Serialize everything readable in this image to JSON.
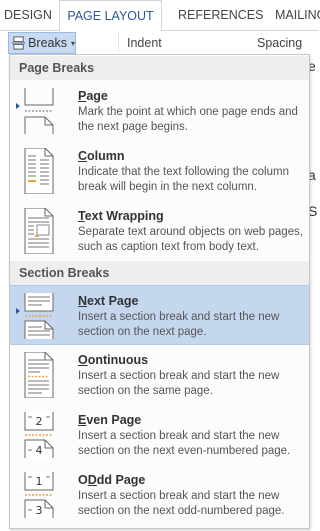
{
  "ribbon": {
    "tabs": [
      {
        "label": "DESIGN"
      },
      {
        "label": "PAGE LAYOUT"
      },
      {
        "label": "REFERENCES"
      },
      {
        "label": "MAILING"
      }
    ],
    "active_tab": "PAGE LAYOUT",
    "breaks_button": {
      "label": "Breaks",
      "icon": "breaks-icon",
      "caret": "▾"
    },
    "indent_label": "Indent",
    "spacing_label": "Spacing"
  },
  "document_background": {
    "visible_glyphs": [
      "e",
      "a",
      "S"
    ]
  },
  "colors": {
    "accent": "#2b579a",
    "hover_bg": "#c5d7ee",
    "section_header_bg": "#eeeeee",
    "page_icon_orange": "#e8a54c"
  },
  "menu": {
    "page_breaks_header": "Page Breaks",
    "section_breaks_header": "Section Breaks",
    "page_breaks": [
      {
        "accel": "P",
        "rest": "age",
        "icon": "page-break-icon",
        "desc": "Mark the point at which one page ends and the next page begins."
      },
      {
        "accel": "C",
        "rest": "olumn",
        "icon": "column-break-icon",
        "desc": "Indicate that the text following the column break will begin in the next column."
      },
      {
        "accel": "T",
        "rest": "ext Wrapping",
        "icon": "text-wrapping-icon",
        "desc": "Separate text around objects on web pages, such as caption text from body text."
      }
    ],
    "section_breaks": [
      {
        "accel": "N",
        "rest": "ext Page",
        "icon": "next-page-icon",
        "desc": "Insert a section break and start the new section on the next page.",
        "selected": true
      },
      {
        "accel": "O",
        "rest": "ontinuous",
        "icon": "continuous-icon",
        "desc": "Insert a section break and start the new section on the same page."
      },
      {
        "accel": "E",
        "rest": "ven Page",
        "icon": "even-page-icon",
        "desc": "Insert a section break and start the new section on the next even-numbered page.",
        "badge_top": "2",
        "badge_bottom": "4"
      },
      {
        "accel": "D",
        "rest": "dd Page",
        "icon": "odd-page-icon",
        "title_prefix": "O",
        "desc": "Insert a section break and start the new section on the next odd-numbered page.",
        "badge_top": "1",
        "badge_bottom": "3"
      }
    ]
  }
}
